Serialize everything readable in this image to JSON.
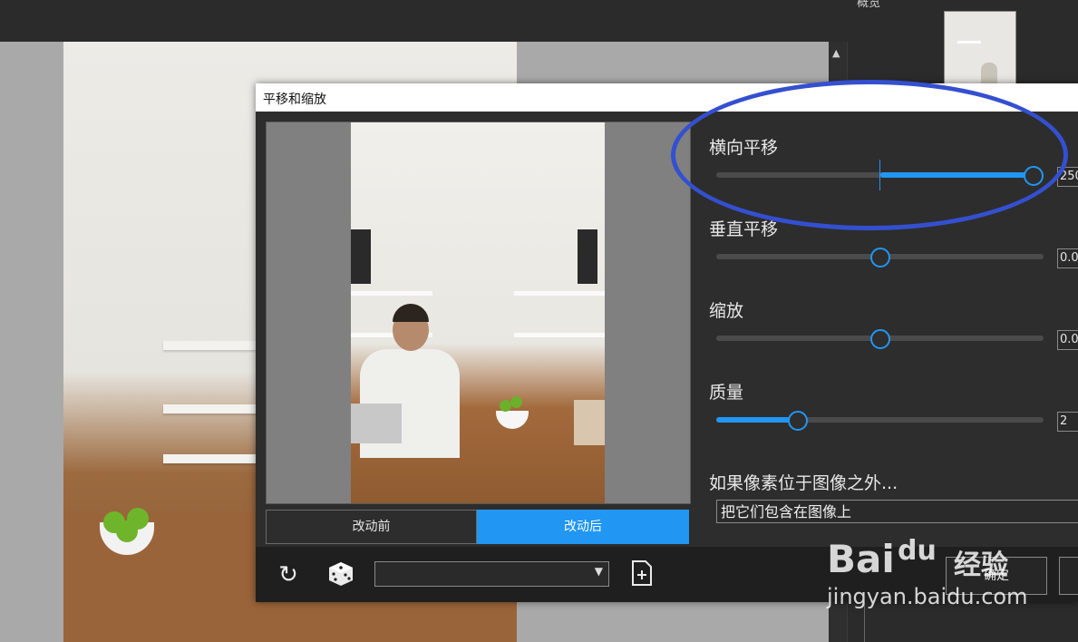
{
  "right_panel": {
    "label": "概览"
  },
  "dialog": {
    "title": "平移和缩放",
    "tabs": {
      "before": "改动前",
      "after": "改动后"
    },
    "controls": {
      "horizontal": {
        "label": "横向平移",
        "value": "250",
        "position": 1.0
      },
      "vertical": {
        "label": "垂直平移",
        "value": "0.0",
        "position": 0.5
      },
      "zoom": {
        "label": "缩放",
        "value": "0.0",
        "position": 0.5
      },
      "quality": {
        "label": "质量",
        "value": "2",
        "position": 0.25
      }
    },
    "outside": {
      "label": "如果像素位于图像之外...",
      "selected": "把它们包含在图像上"
    },
    "buttons": {
      "ok": "确定"
    },
    "icons": {
      "reset": "reset-icon",
      "random": "dice-icon",
      "save": "file-add-icon",
      "dropdown": "chevron-down-icon"
    }
  },
  "watermark": {
    "brand": "Bai",
    "brand2": "du",
    "cn": "经验",
    "url": "jingyan.baidu.com"
  },
  "colors": {
    "accent": "#2196f3",
    "annotation": "#3450d0"
  }
}
